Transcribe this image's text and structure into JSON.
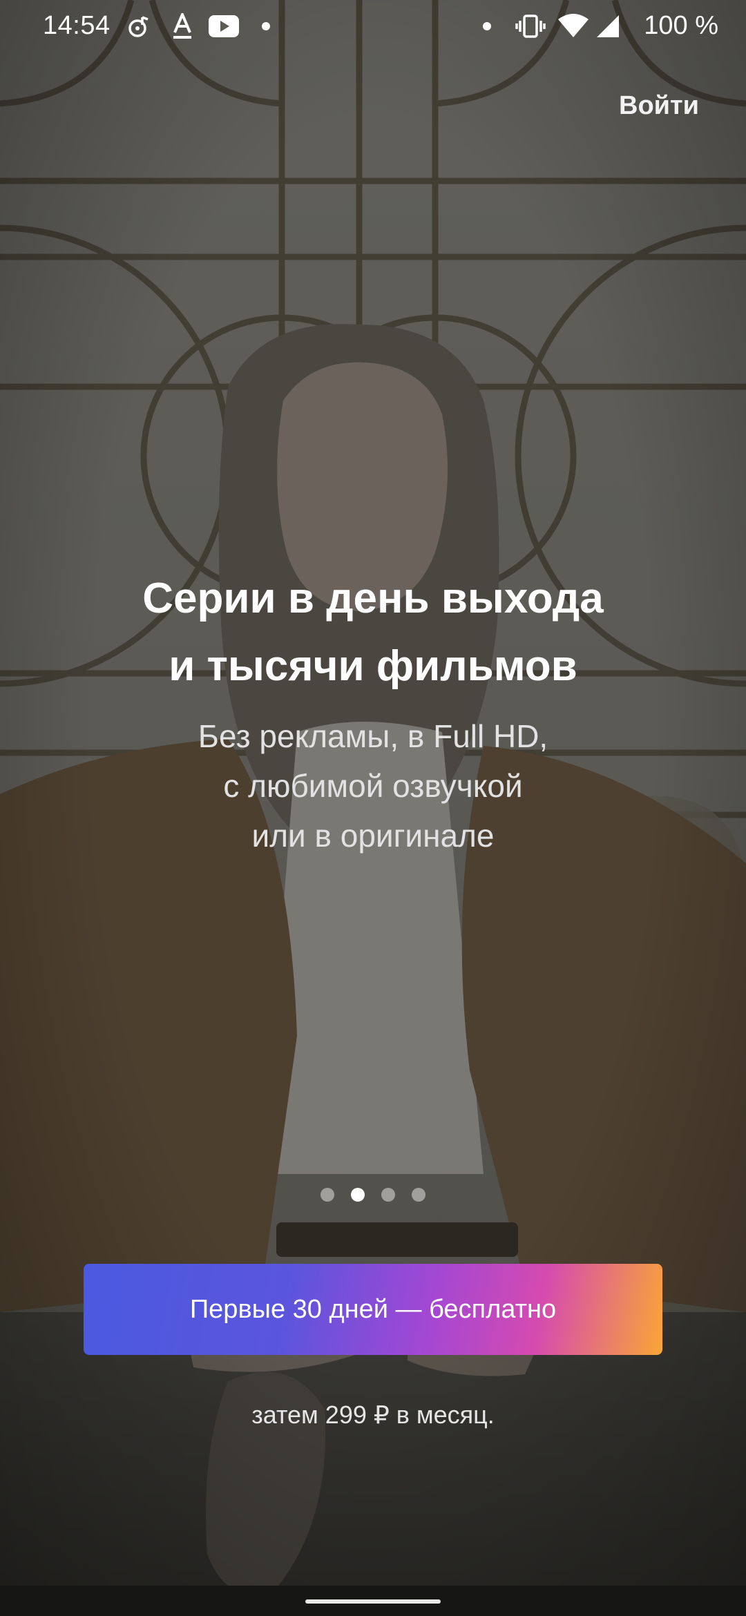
{
  "status_bar": {
    "time": "14:54",
    "battery": "100 %",
    "left_icons": [
      "music-note-icon",
      "a-underline-icon",
      "youtube-icon",
      "notification-dot-icon"
    ],
    "right_icons": [
      "notification-dot-icon",
      "vibrate-icon",
      "wifi-icon",
      "cell-signal-icon"
    ]
  },
  "header": {
    "login_label": "Войти"
  },
  "hero": {
    "title_line1": "Серии в день выхода",
    "title_line2": "и тысячи фильмов",
    "subtitle_line1": "Без рекламы, в Full HD,",
    "subtitle_line2": "с любимой озвучкой",
    "subtitle_line3": "или в оригинале"
  },
  "pager": {
    "count": 4,
    "active_index": 1
  },
  "cta": {
    "button_label": "Первые 30 дней — бесплатно",
    "price_note": "затем 299 ₽ в месяц."
  },
  "colors": {
    "gradient_start": "#4a5ae0",
    "gradient_mid": "#a447d3",
    "gradient_end": "#f9a636",
    "overlay": "#2b2a27"
  }
}
